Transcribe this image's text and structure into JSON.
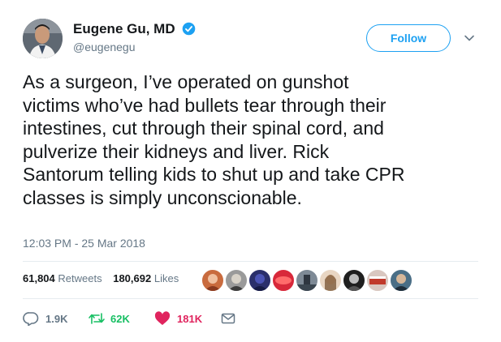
{
  "author": {
    "display_name": "Eugene Gu, MD",
    "handle": "@eugenegu",
    "avatar_icon": "profile-photo",
    "verified_icon": "verified-badge-icon"
  },
  "follow_label": "Follow",
  "tweet": {
    "text": "As a surgeon, I’ve operated on gunshot\nvictims who’ve had bullets tear through their\nintestines, cut through their spinal cord, and\npulverize their kidneys and liver. Rick\nSantorum telling kids to shut up and take CPR\nclasses is simply unconscionable.",
    "timestamp": "12:03 PM - 25 Mar 2018"
  },
  "stats": {
    "retweets_count": "61,804",
    "retweets_label": "Retweets",
    "likes_count": "180,692",
    "likes_label": "Likes"
  },
  "actions": {
    "reply_count": "1.9K",
    "retweet_count": "62K",
    "like_count": "181K"
  },
  "colors": {
    "accent": "#1da1f2",
    "retweet_green": "#17bf63",
    "like_red": "#e0245e",
    "secondary_text": "#657786"
  }
}
